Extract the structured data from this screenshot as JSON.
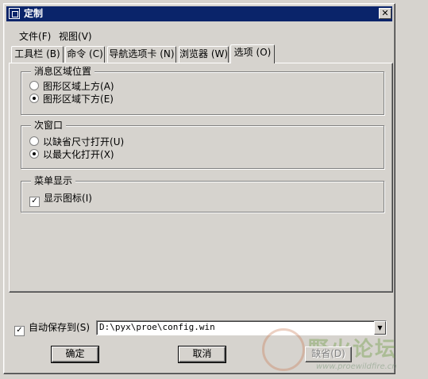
{
  "window": {
    "title": "定制"
  },
  "menu": [
    {
      "label": "文件",
      "accel": "(F)"
    },
    {
      "label": "视图",
      "accel": "(V)"
    }
  ],
  "tabs": [
    {
      "label": "工具栏",
      "accel": "(B)"
    },
    {
      "label": "命令",
      "accel": "(C)"
    },
    {
      "label": "导航选项卡",
      "accel": "(N)"
    },
    {
      "label": "浏览器",
      "accel": "(W)"
    },
    {
      "label": "选项",
      "accel": "(O)",
      "active": true
    }
  ],
  "groups": {
    "message_area": {
      "legend": "消息区域位置",
      "options": [
        {
          "label": "图形区域上方",
          "accel": "(A)",
          "selected": false
        },
        {
          "label": "图形区域下方",
          "accel": "(E)",
          "selected": true
        }
      ]
    },
    "sub_window": {
      "legend": "次窗口",
      "options": [
        {
          "label": "以缺省尺寸打开",
          "accel": "(U)",
          "selected": false
        },
        {
          "label": "以最大化打开",
          "accel": "(X)",
          "selected": true
        }
      ]
    },
    "menu_display": {
      "legend": "菜单显示",
      "options": [
        {
          "label": "显示图标",
          "accel": "(I)",
          "checked": true
        }
      ]
    }
  },
  "autosave": {
    "label": "自动保存到",
    "accel": "(S)",
    "checked": true,
    "path": "D:\\pyx\\proe\\config.win"
  },
  "buttons": {
    "ok": "确定",
    "cancel": "取消",
    "default": "缺省",
    "default_accel": "(D)"
  },
  "watermark": {
    "text": "野火论坛",
    "url": "www.proewildfire.cn"
  }
}
